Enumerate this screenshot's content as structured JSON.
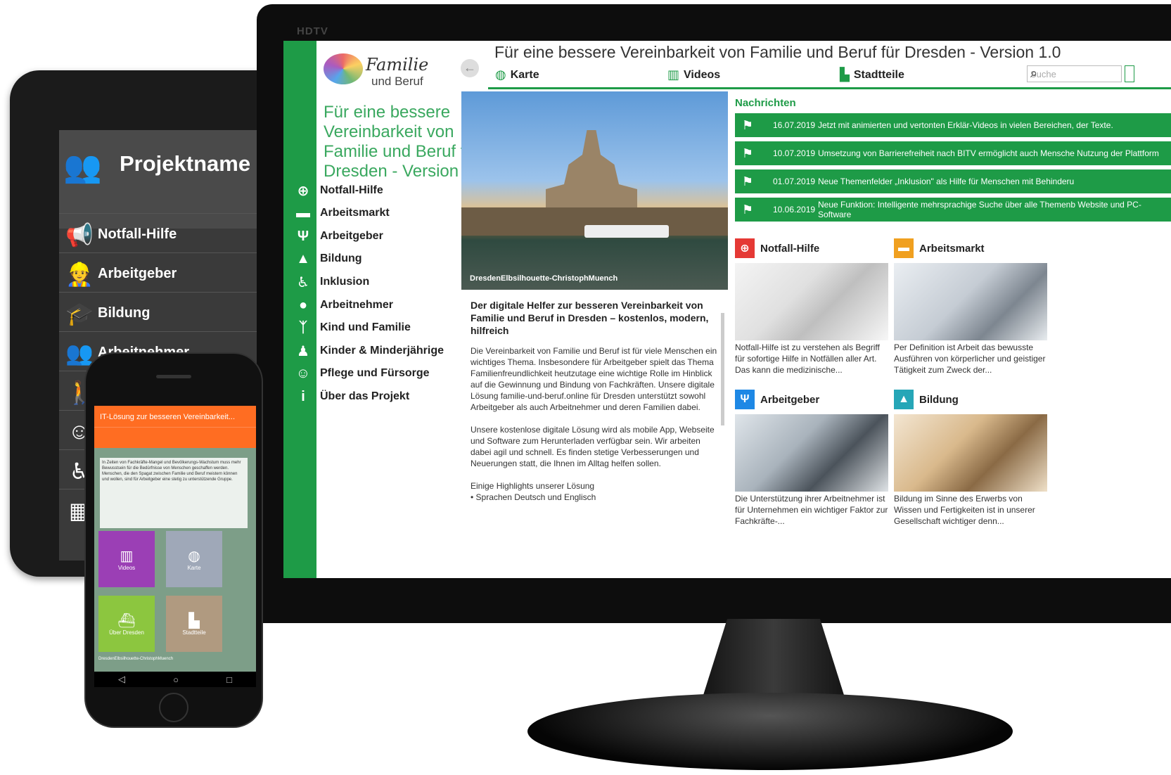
{
  "tablet": {
    "project_name": "Projektname",
    "items": [
      {
        "label": "Notfall-Hilfe",
        "icon": "megaphone-icon"
      },
      {
        "label": "Arbeitgeber",
        "icon": "worker-icon"
      },
      {
        "label": "Bildung",
        "icon": "graduation-cap-icon"
      },
      {
        "label": "Arbeitnehmer",
        "icon": "group-icon"
      }
    ]
  },
  "monitor": {
    "brand_line1": "Familie",
    "brand_line2": "und Beruf",
    "tagline": "Für eine bessere Vereinbarkeit von Familie und Beruf für Dresden - Version 1.0",
    "title": "Für eine bessere Vereinbarkeit von Familie und Beruf für Dresden - Version 1.0",
    "nav": [
      {
        "label": "Notfall-Hilfe",
        "icon": "first-aid-icon"
      },
      {
        "label": "Arbeitsmarkt",
        "icon": "briefcase-icon"
      },
      {
        "label": "Arbeitgeber",
        "icon": "tie-icon"
      },
      {
        "label": "Bildung",
        "icon": "graduation-cap-icon"
      },
      {
        "label": "Inklusion",
        "icon": "wheelchair-icon"
      },
      {
        "label": "Arbeitnehmer",
        "icon": "person-icon"
      },
      {
        "label": "Kind und Familie",
        "icon": "family-icon"
      },
      {
        "label": "Kinder & Minderjährige",
        "icon": "child-icon"
      },
      {
        "label": "Pflege und Fürsorge",
        "icon": "care-icon"
      },
      {
        "label": "Über das Projekt",
        "icon": "info-icon"
      }
    ],
    "topnav": [
      {
        "label": "Karte",
        "icon": "globe-icon"
      },
      {
        "label": "Videos",
        "icon": "clapper-icon"
      },
      {
        "label": "Stadtteile",
        "icon": "city-icon"
      }
    ],
    "search_placeholder": "Suche",
    "hero_caption": "DresdenElbsilhouette-ChristophMuench",
    "article": {
      "heading": "Der digitale Helfer zur besseren Vereinbarkeit von Familie und Beruf in Dresden  – kostenlos, modern, hilfreich",
      "p1": "Die Vereinbarkeit von Familie und Beruf ist für viele Menschen ein wichtiges Thema. Insbesondere für Arbeitgeber spielt das Thema Familienfreundlichkeit heutzutage eine wichtige Rolle im Hinblick auf die Gewinnung und Bindung von Fachkräften. Unsere digitale Lösung familie-und-beruf.online für Dresden unterstützt sowohl Arbeitgeber als auch Arbeitnehmer und deren Familien dabei.",
      "p2": "Unsere kostenlose digitale Lösung wird als mobile App, Webseite und Software zum Herunterladen verfügbar sein. Wir arbeiten dabei agil und schnell. Es finden stetige Verbesserungen und Neuerungen statt, die Ihnen im Alltag helfen sollen.",
      "p3": "Einige Highlights unserer Lösung",
      "p4": "• Sprachen Deutsch und Englisch"
    },
    "news_title": "Nachrichten",
    "news": [
      {
        "date": "16.07.2019",
        "text": "Jetzt mit animierten und vertonten Erklär-Videos in vielen Bereichen, der Texte."
      },
      {
        "date": "10.07.2019",
        "text": "Umsetzung von Barrierefreiheit nach BITV ermöglicht auch Mensche Nutzung der Plattform"
      },
      {
        "date": "01.07.2019",
        "text": "Neue Themenfelder „Inklusion\" als Hilfe für Menschen mit Behinderu"
      },
      {
        "date": "10.06.2019",
        "text": "Neue Funktion: Intelligente mehrsprachige Suche über alle Themenb Website und PC-Software"
      }
    ],
    "cards": [
      {
        "title": "Notfall-Hilfe",
        "text": "Notfall-Hilfe ist zu verstehen als Begriff für sofortige Hilfe in Notfällen aller Art. Das kann die medizinische...",
        "color": "#e53935",
        "icon": "first-aid-icon"
      },
      {
        "title": "Arbeitsmarkt",
        "text": "Per Definition ist Arbeit das bewusste Ausführen von körperlicher und geistiger Tätigkeit zum Zweck der...",
        "color": "#f0a020",
        "icon": "briefcase-icon"
      },
      {
        "title": "Arbeitgeber",
        "text": "Die Unterstützung ihrer Arbeitnehmer ist für Unternehmen ein wichtiger Faktor zur Fachkräfte-...",
        "color": "#1e88e5",
        "icon": "tie-icon"
      },
      {
        "title": "Bildung",
        "text": "Bildung im Sinne des Erwerbs von Wissen und Fertigkeiten ist in unserer Gesellschaft wichtiger denn...",
        "color": "#26a6b7",
        "icon": "graduation-cap-icon"
      }
    ]
  },
  "phone": {
    "title": "IT-Lösung zur besseren Vereinbarkeit...",
    "text": "In Zeiten von Fachkräfte-Mangel und Bevölkerungs-Wachstum muss mehr Bewusstsein für die Bedürfnisse von Menschen geschaffen werden. Menschen, die den Spagat zwischen Familie und Beruf meistern können und wollen, sind für Arbeitgeber eine stetig zu unterstützende Gruppe.",
    "tiles": [
      {
        "label": "Videos",
        "color": "#9b3fb5"
      },
      {
        "label": "Karte",
        "color": "#9fa8b8"
      },
      {
        "label": "Über Dresden",
        "color": "#8cc63f"
      },
      {
        "label": "Stadtteile",
        "color": "#b09a80"
      }
    ],
    "caption": "DresdenElbsilhouette-ChristophMuench"
  }
}
